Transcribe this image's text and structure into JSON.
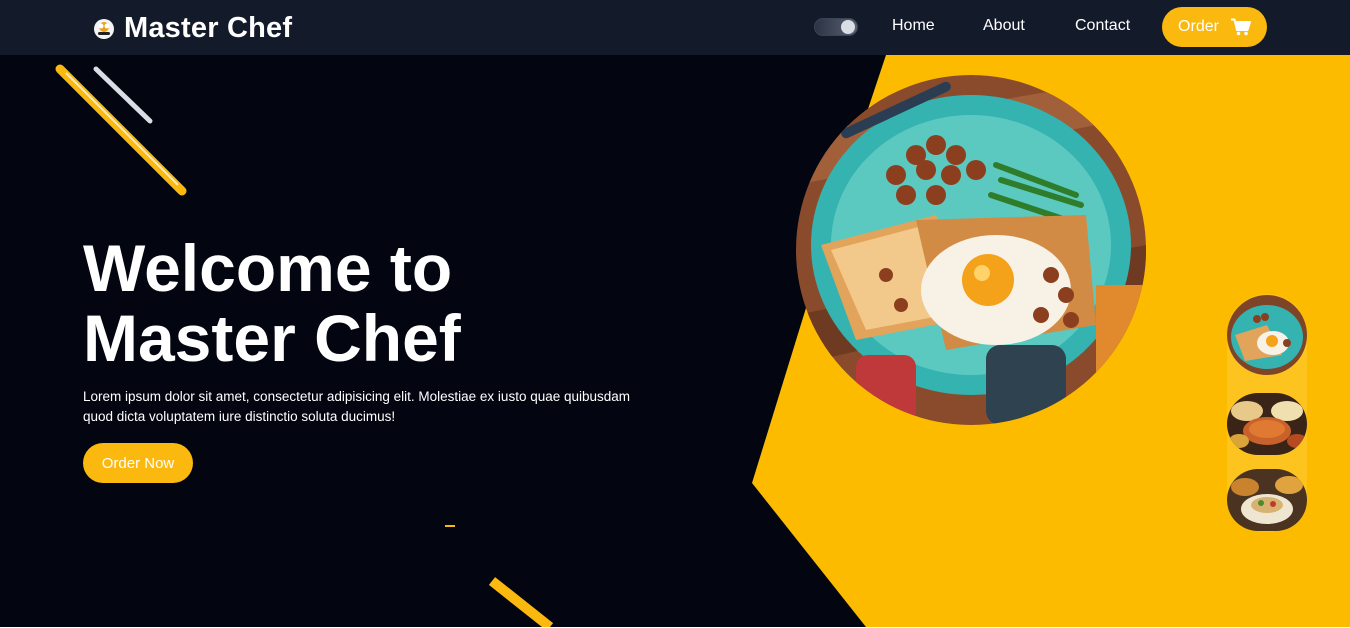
{
  "brand": {
    "name": "Master Chef"
  },
  "nav": {
    "home": "Home",
    "about": "About",
    "contact": "Contact",
    "order_label": "Order",
    "order_icon": "cart-icon",
    "theme_toggle_icon": "theme-toggle"
  },
  "hero": {
    "title": "Welcome to Master Chef",
    "description": "Lorem ipsum dolor sit amet, consectetur adipisicing elit. Molestiae ex iusto quae quibusdam quod dicta voluptatem iure distinctio soluta ducimus!",
    "cta": "Order Now"
  },
  "gallery": {
    "main_image": "breakfast-plate-image",
    "thumbnails": [
      "breakfast-plate-thumbnail",
      "curry-bowls-thumbnail",
      "rice-dish-thumbnail"
    ]
  },
  "colors": {
    "accent": "#fbb80e",
    "navbar": "#131a2a",
    "hero_background": "#030610",
    "hero_panel": "#fdbb00"
  }
}
